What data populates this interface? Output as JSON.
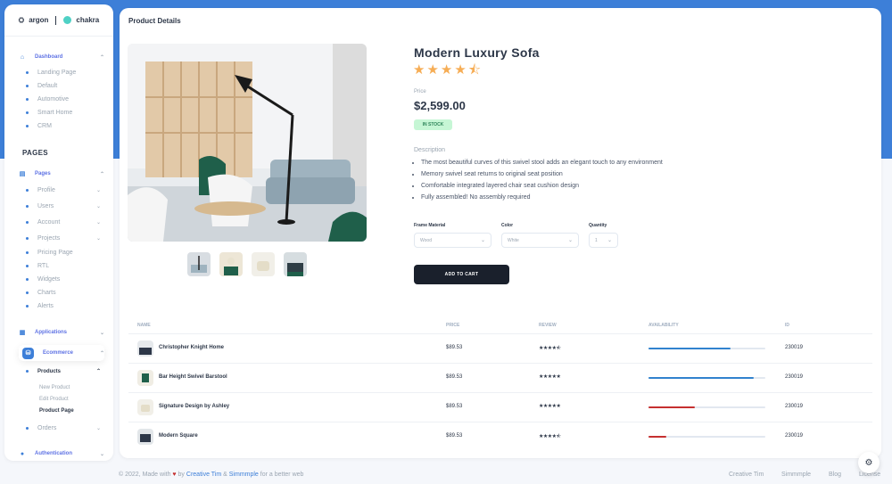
{
  "brand": {
    "left": "argon",
    "right": "chakra"
  },
  "sidebar": {
    "dashboard": {
      "label": "Dashboard",
      "items": [
        "Landing Page",
        "Default",
        "Automotive",
        "Smart Home",
        "CRM"
      ]
    },
    "pages_heading": "PAGES",
    "pages": {
      "label": "Pages",
      "items": [
        "Profile",
        "Users",
        "Account",
        "Projects",
        "Pricing Page",
        "RTL",
        "Widgets",
        "Charts",
        "Alerts"
      ]
    },
    "applications": "Applications",
    "ecommerce": "Ecommerce",
    "products": "Products",
    "products_items": [
      "New Product",
      "Edit Product",
      "Product Page"
    ],
    "orders": "Orders",
    "authentication": "Authentication"
  },
  "card": {
    "title": "Product Details"
  },
  "product": {
    "name": "Modern Luxury Sofa",
    "rating": 4.5,
    "price_label": "Price",
    "price": "$2,599.00",
    "stock": "IN STOCK",
    "description_label": "Description",
    "bullets": [
      "The most beautiful curves of this swivel stool adds an elegant touch to any environment",
      "Memory swivel seat returns to original seat position",
      "Comfortable integrated layered chair seat cushion design",
      "Fully assembled! No assembly required"
    ],
    "frame_label": "Frame Material",
    "frame_value": "Wood",
    "color_label": "Color",
    "color_value": "White",
    "qty_label": "Quantity",
    "qty_value": "1",
    "add_to_cart": "ADD TO CART"
  },
  "table": {
    "headers": [
      "NAME",
      "PRICE",
      "REVIEW",
      "AVAILABILITY",
      "ID"
    ],
    "rows": [
      {
        "name": "Christopher Knight Home",
        "price": "$89.53",
        "review": "★★★★⯪",
        "availability": 0.7,
        "color": "#3182ce",
        "id": "230019"
      },
      {
        "name": "Bar Height Swivel Barstool",
        "price": "$89.53",
        "review": "★★★★★",
        "availability": 0.9,
        "color": "#3182ce",
        "id": "230019"
      },
      {
        "name": "Signature Design by Ashley",
        "price": "$89.53",
        "review": "★★★★★",
        "availability": 0.4,
        "color": "#c53030",
        "id": "230019"
      },
      {
        "name": "Modern Square",
        "price": "$89.53",
        "review": "★★★★⯪",
        "availability": 0.15,
        "color": "#c53030",
        "id": "230019"
      }
    ]
  },
  "footer": {
    "prefix": "© 2022, Made with",
    "by": "by",
    "author1": "Creative Tim",
    "amp": "&",
    "author2": "Simmmple",
    "suffix": "for a better web",
    "links": [
      "Creative Tim",
      "Simmmple",
      "Blog",
      "License"
    ]
  }
}
